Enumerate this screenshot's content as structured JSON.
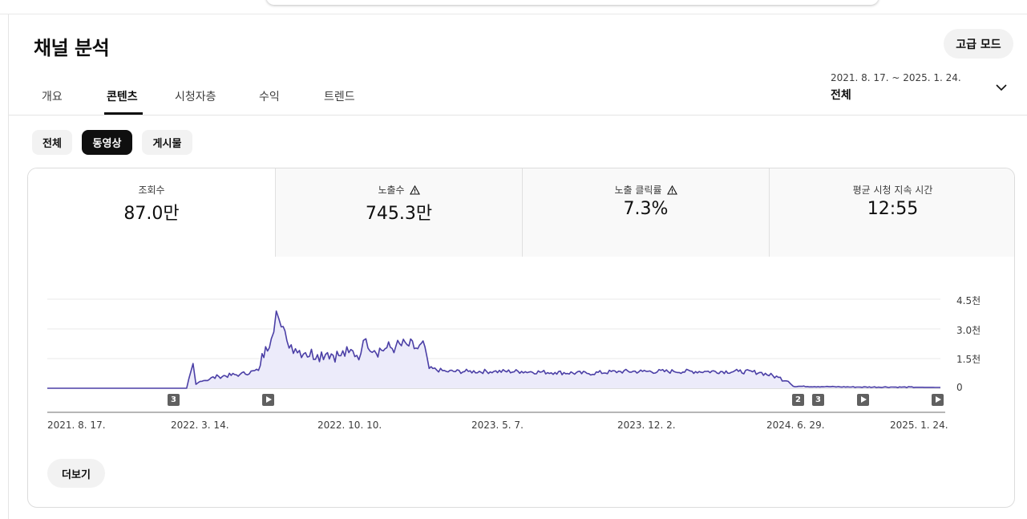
{
  "header": {
    "title": "채널 분석",
    "advanced_mode_label": "고급 모드"
  },
  "tabs": [
    {
      "label": "개요",
      "active": false
    },
    {
      "label": "콘텐츠",
      "active": true
    },
    {
      "label": "시청자층",
      "active": false
    },
    {
      "label": "수익",
      "active": false
    },
    {
      "label": "트렌드",
      "active": false
    }
  ],
  "date_selector": {
    "range": "2021. 8. 17. ~ 2025. 1. 24.",
    "scope": "전체",
    "icon": "chevron-down-icon"
  },
  "content_filters": [
    {
      "label": "전체",
      "active": false
    },
    {
      "label": "동영상",
      "active": true
    },
    {
      "label": "게시물",
      "active": false
    }
  ],
  "metrics": [
    {
      "label": "조회수",
      "value": "87.0만",
      "warning": false
    },
    {
      "label": "노출수",
      "value": "745.3만",
      "warning": true
    },
    {
      "label": "노출 클릭률",
      "value": "7.3%",
      "warning": true
    },
    {
      "label": "평균 시청 지속 시간",
      "value": "12:55",
      "warning": false
    }
  ],
  "markers": [
    {
      "type": "count",
      "label": "3"
    },
    {
      "type": "play",
      "label": ""
    },
    {
      "type": "count",
      "label": "2"
    },
    {
      "type": "count",
      "label": "3"
    },
    {
      "type": "play",
      "label": ""
    },
    {
      "type": "play",
      "label": ""
    }
  ],
  "more_button_label": "더보기",
  "chart_data": {
    "type": "area",
    "metric": "조회수",
    "x_tick_labels": [
      "2021. 8. 17.",
      "2022. 3. 14.",
      "2022. 10. 10.",
      "2023. 5. 7.",
      "2023. 12. 2.",
      "2024. 6. 29.",
      "2025. 1. 24."
    ],
    "y_tick_labels": [
      "4.5천",
      "3.0천",
      "1.5천",
      "0"
    ],
    "ylim": [
      0,
      4500
    ],
    "grid": true,
    "line_color": "#4b3fa6",
    "fill_color": "#ecebfa",
    "x": [
      "2021-08-17",
      "2022-03-01",
      "2022-03-10",
      "2022-03-14",
      "2022-03-20",
      "2022-04-15",
      "2022-05-15",
      "2022-06-10",
      "2022-06-20",
      "2022-06-28",
      "2022-07-05",
      "2022-07-12",
      "2022-07-20",
      "2022-08-01",
      "2022-08-15",
      "2022-09-01",
      "2022-09-15",
      "2022-10-01",
      "2022-10-15",
      "2022-11-01",
      "2022-11-08",
      "2022-11-20",
      "2022-12-05",
      "2022-12-20",
      "2023-01-05",
      "2023-01-20",
      "2023-01-30",
      "2023-02-05",
      "2023-03-01",
      "2023-04-01",
      "2023-05-07",
      "2023-06-15",
      "2023-08-01",
      "2023-09-15",
      "2023-11-01",
      "2023-12-02",
      "2024-01-15",
      "2024-03-01",
      "2024-04-15",
      "2024-05-15",
      "2024-06-10",
      "2024-06-24",
      "2024-07-01",
      "2024-08-15",
      "2024-10-01",
      "2024-11-15",
      "2025-01-24"
    ],
    "y": [
      0,
      0,
      1250,
      200,
      350,
      600,
      700,
      900,
      2100,
      2500,
      3900,
      3100,
      2400,
      2000,
      1800,
      1700,
      1800,
      1650,
      1800,
      1750,
      2500,
      1900,
      2000,
      2100,
      2200,
      2000,
      2100,
      1000,
      850,
      850,
      850,
      850,
      800,
      750,
      850,
      850,
      850,
      850,
      850,
      800,
      550,
      350,
      100,
      80,
      60,
      60,
      40
    ]
  }
}
